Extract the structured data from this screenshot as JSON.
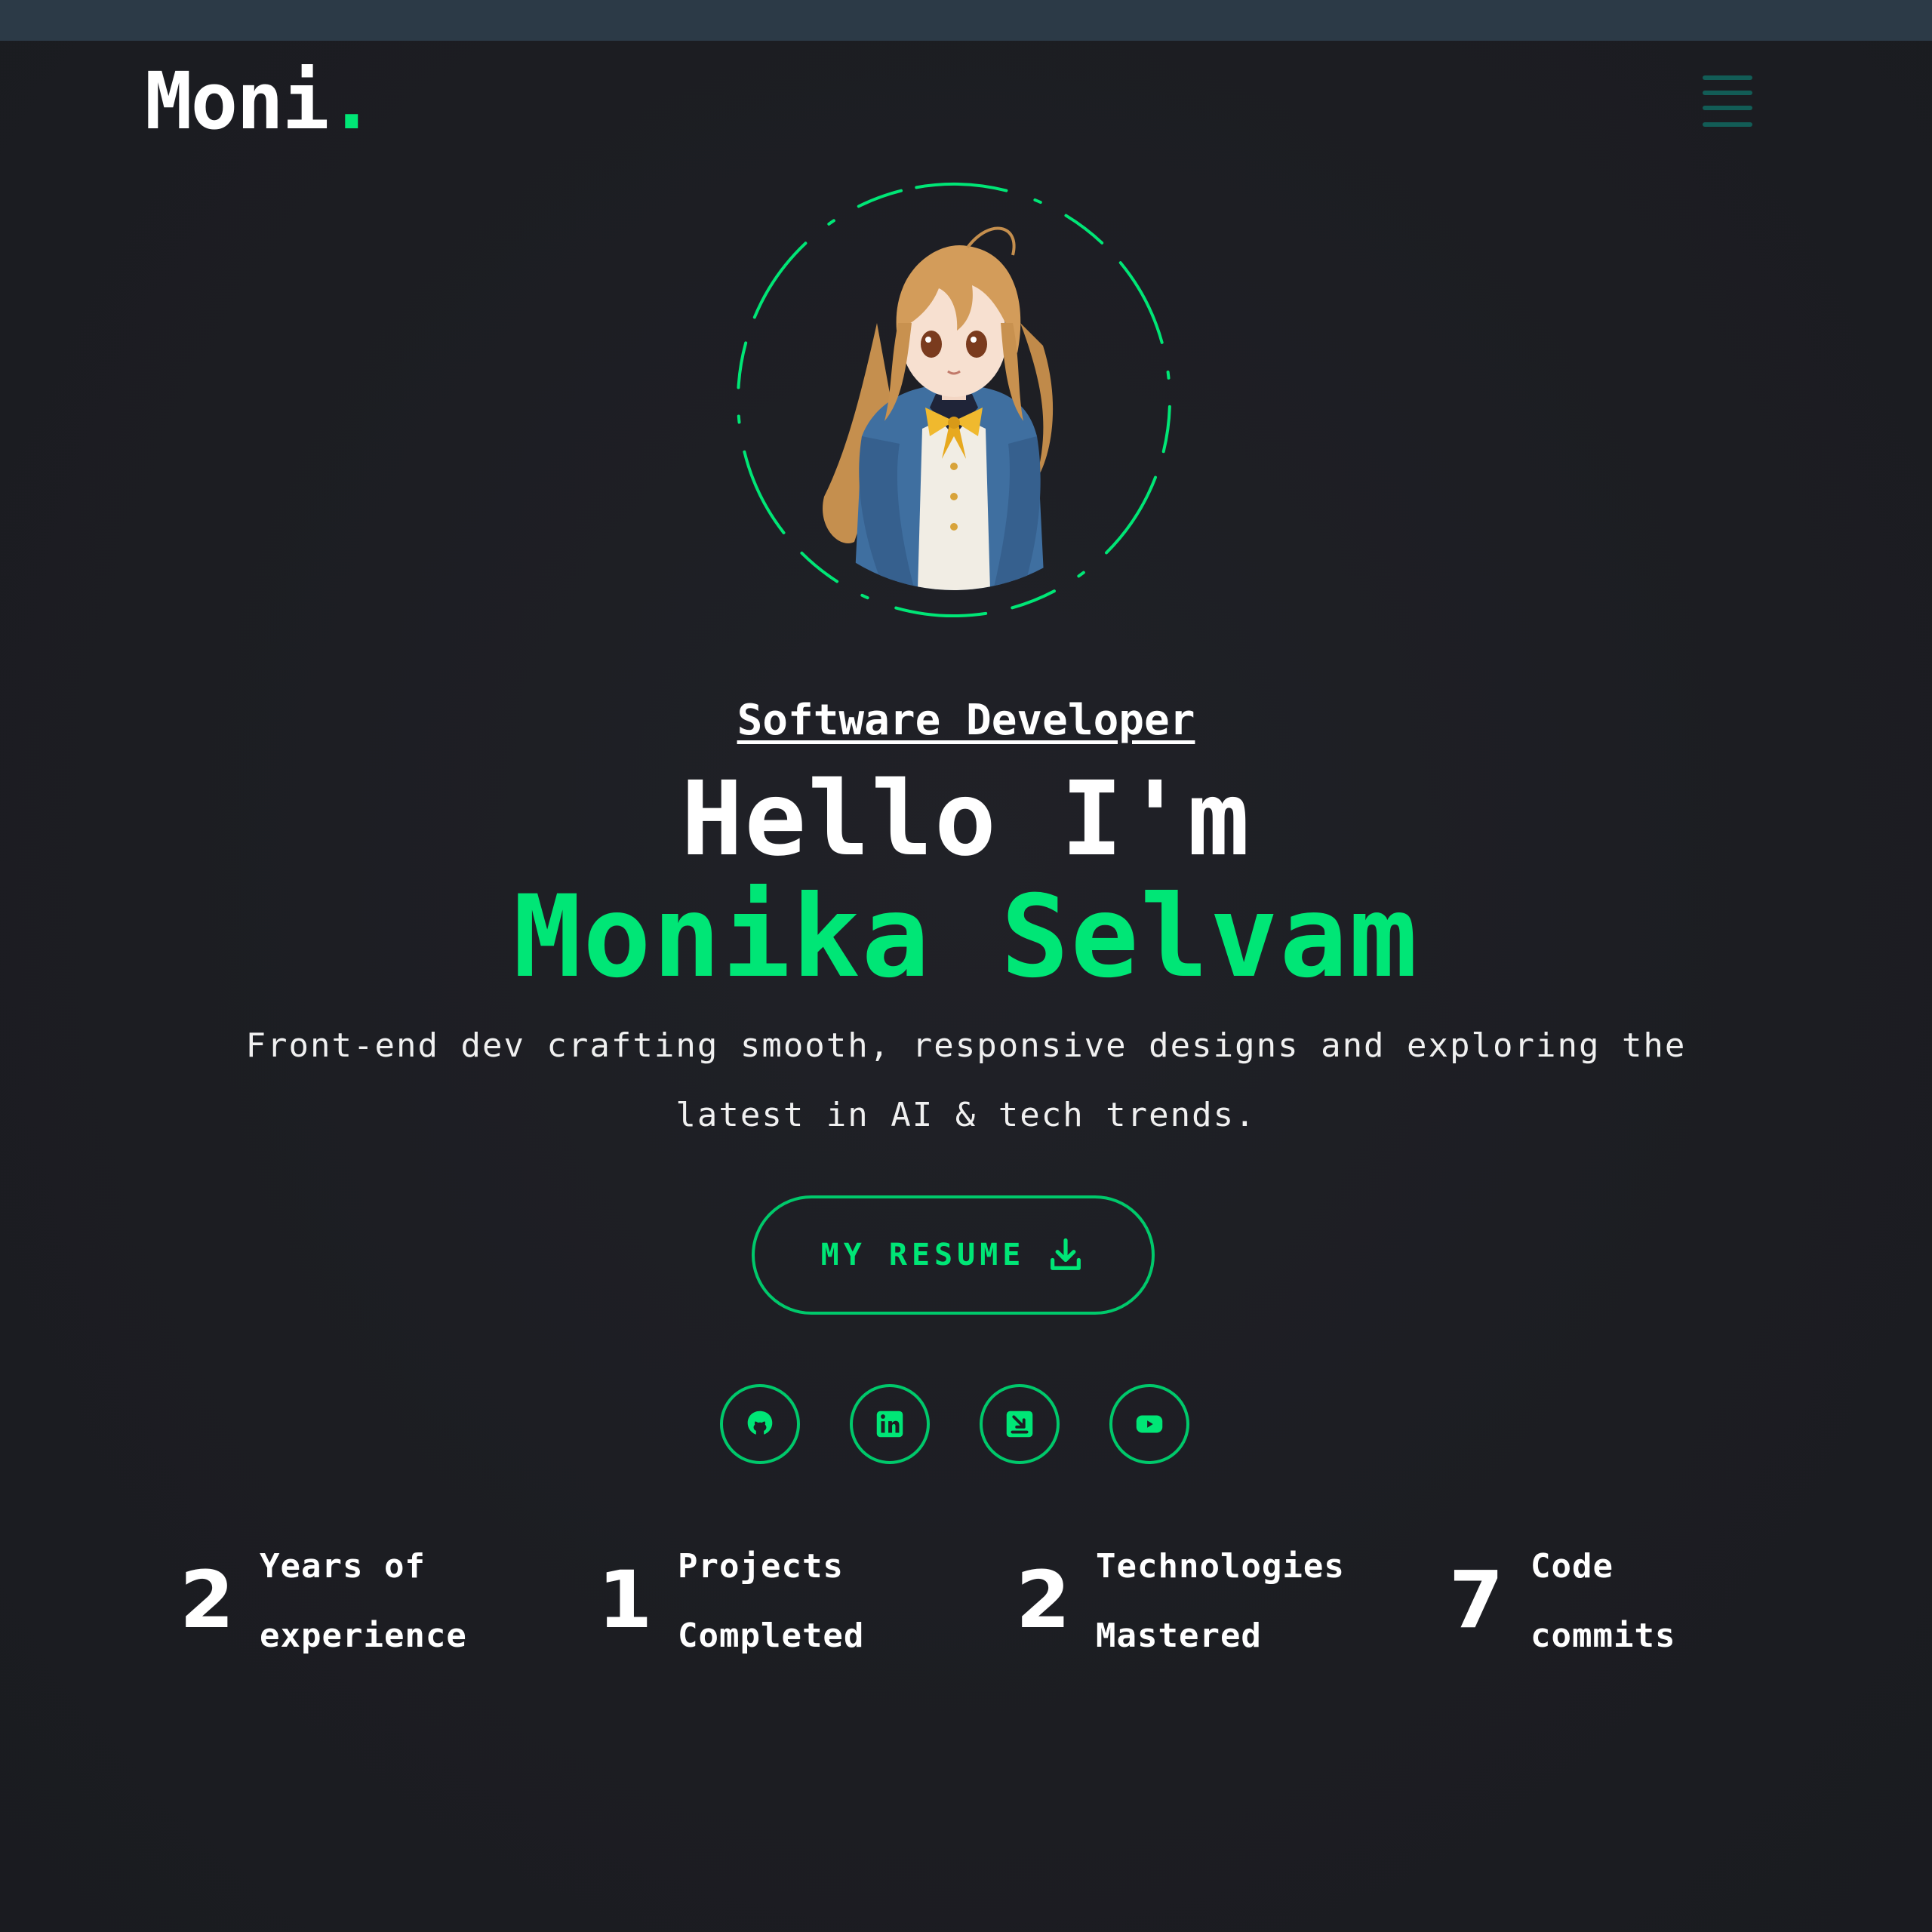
{
  "header": {
    "logo_text": "Moni",
    "logo_dot": ".",
    "menu_icon": "hamburger-menu-icon"
  },
  "hero": {
    "role": "Software Developer",
    "greeting": "Hello I'm",
    "name": "Monika Selvam",
    "tagline": "Front-end dev crafting smooth, responsive designs and exploring the latest in AI & tech trends.",
    "resume_label": "MY RESUME",
    "resume_icon": "download-icon",
    "avatar_alt": "anime-style portrait avatar"
  },
  "socials": [
    {
      "icon": "github-icon"
    },
    {
      "icon": "linkedin-icon"
    },
    {
      "icon": "leetcode-icon"
    },
    {
      "icon": "youtube-icon"
    }
  ],
  "stats": [
    {
      "number": "2",
      "label_line1": "Years of",
      "label_line2": "experience"
    },
    {
      "number": "1",
      "label_line1": "Projects",
      "label_line2": "Completed"
    },
    {
      "number": "2",
      "label_line1": "Technologies",
      "label_line2": "Mastered"
    },
    {
      "number": "7",
      "label_line1": "Code",
      "label_line2": "commits"
    }
  ],
  "colors": {
    "background": "#1d1e23",
    "topbar": "#2c3a47",
    "accent": "#00e676",
    "text": "#ffffff",
    "menu": "#11675f"
  }
}
